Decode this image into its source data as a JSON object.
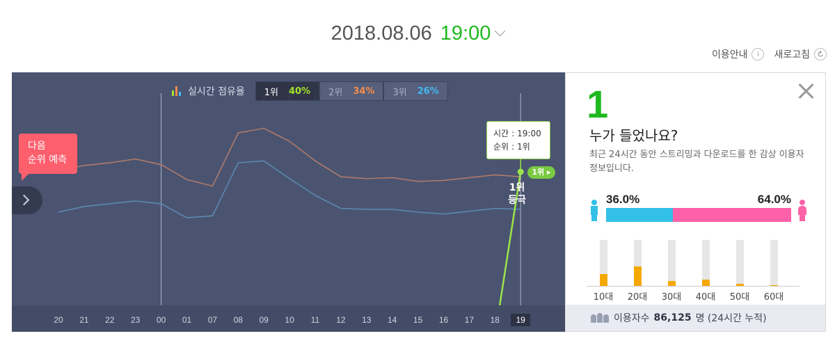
{
  "header": {
    "date": "2018.08.06",
    "time": "19:00",
    "guide_label": "이용안내",
    "guide_icon": "i",
    "refresh_label": "새로고침"
  },
  "chart": {
    "title": "실시간 점유율",
    "tabs": [
      {
        "rank": "1위",
        "pct": "40%",
        "color": "#a6e22e"
      },
      {
        "rank": "2위",
        "pct": "34%",
        "color": "#f58b48"
      },
      {
        "rank": "3위",
        "pct": "26%",
        "color": "#44b7f0"
      }
    ],
    "prediction": {
      "line1": "다음",
      "line2": "순위 예측"
    },
    "tooltip": {
      "time_label": "시간",
      "time_value": "19:00",
      "rank_label": "순위",
      "rank_value": "1위"
    },
    "current_badge": "1위",
    "entry_label_1": "1위",
    "entry_label_2": "등극",
    "colors": {
      "bg": "#4a5470",
      "series_orange": "#b07a6a",
      "series_blue": "#5b88b0",
      "highlight": "#9be34a"
    }
  },
  "chart_data": {
    "type": "line",
    "x": [
      "20",
      "21",
      "22",
      "23",
      "00",
      "01",
      "07",
      "08",
      "09",
      "10",
      "11",
      "12",
      "13",
      "14",
      "15",
      "16",
      "17",
      "18",
      "19"
    ],
    "series": [
      {
        "values": [
          34.5,
          35.0,
          35.3,
          35.7,
          35.1,
          33.5,
          32.8,
          38.5,
          39.0,
          37.6,
          35.5,
          33.8,
          33.6,
          33.7,
          33.3,
          33.4,
          33.7,
          34.0,
          33.8
        ]
      },
      {
        "values": [
          30.0,
          30.6,
          30.9,
          31.2,
          30.9,
          29.4,
          29.6,
          35.3,
          35.5,
          33.6,
          31.8,
          30.4,
          30.3,
          30.3,
          30.0,
          29.8,
          30.1,
          30.4,
          30.3
        ]
      }
    ],
    "highlight_x": "19"
  },
  "panel": {
    "rank": "1",
    "question": "누가 들었나요?",
    "desc": "최근 24시간 동안 스트리밍과 다운로드를 한 감상 이용자 정보입니다.",
    "male_pct": "36.0%",
    "female_pct": "64.0%",
    "male_value": 36.0,
    "colors": {
      "male": "#33c0e8",
      "female": "#ff61a8",
      "age": "#f5a800"
    },
    "ages": [
      {
        "label": "10대",
        "value": 0.26
      },
      {
        "label": "20대",
        "value": 0.42
      },
      {
        "label": "30대",
        "value": 0.1
      },
      {
        "label": "40대",
        "value": 0.13
      },
      {
        "label": "50대",
        "value": 0.05
      },
      {
        "label": "60대",
        "value": 0.02
      }
    ],
    "users_label": "이용자수",
    "users_count": "86,125",
    "users_unit": "명 (24시간 누적)"
  }
}
